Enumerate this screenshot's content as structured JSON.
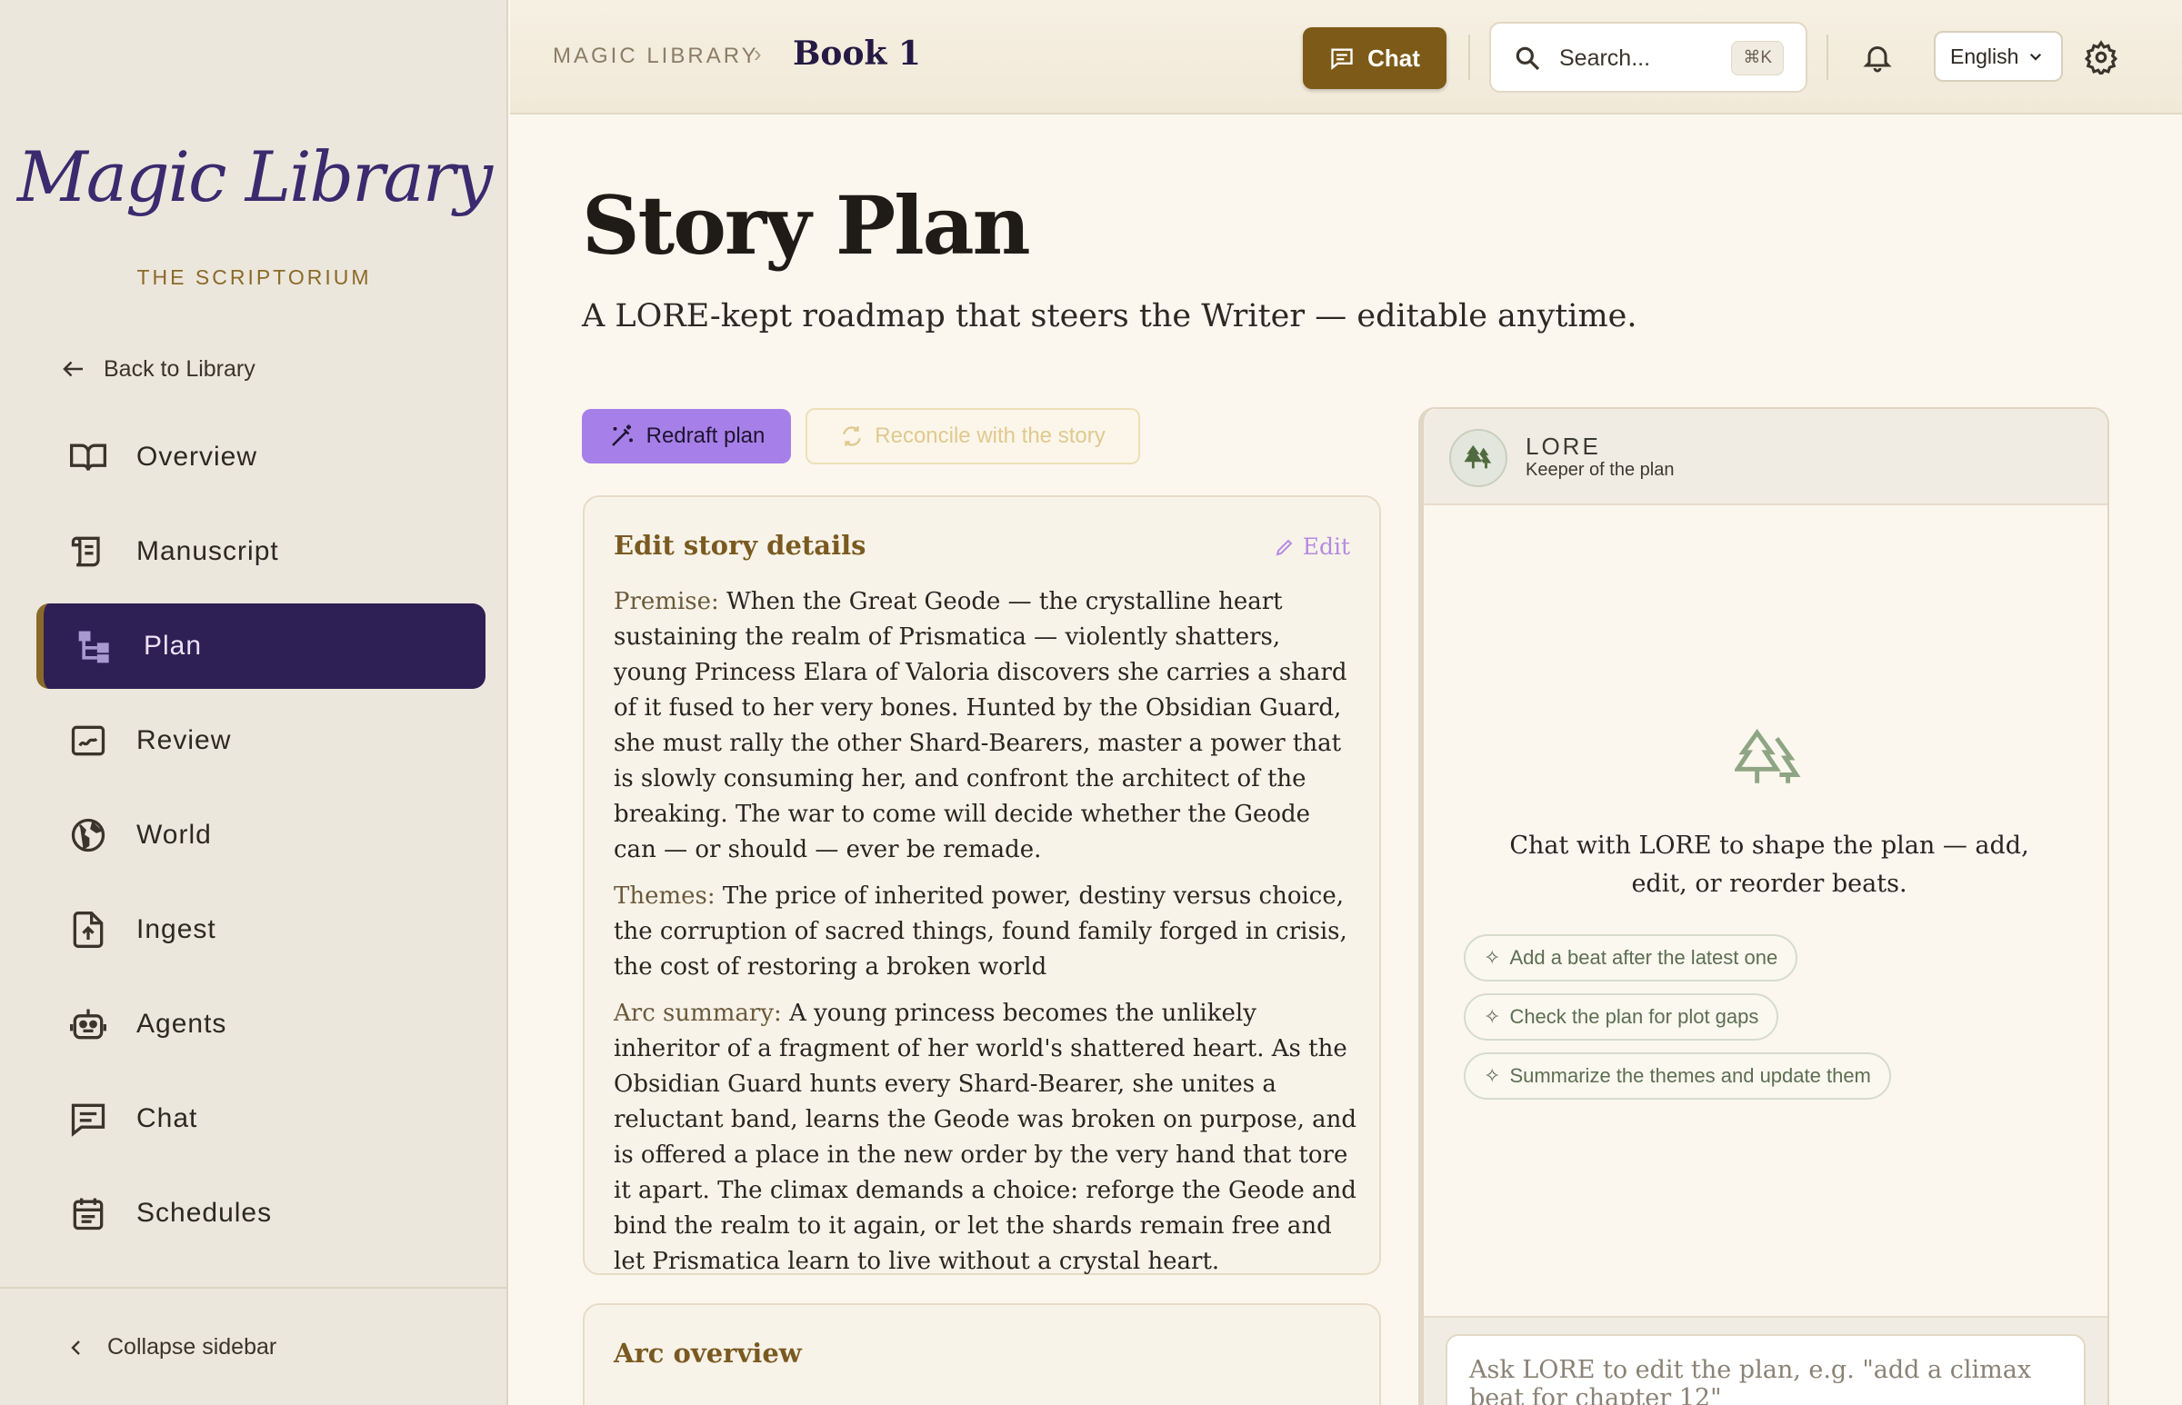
{
  "sidebar": {
    "logo": "Magic Library",
    "subtitle": "THE SCRIPTORIUM",
    "back": "Back to Library",
    "items": [
      {
        "label": "Overview",
        "icon": "open-book-icon"
      },
      {
        "label": "Manuscript",
        "icon": "scroll-icon"
      },
      {
        "label": "Plan",
        "icon": "hierarchy-icon",
        "active": true
      },
      {
        "label": "Review",
        "icon": "review-icon"
      },
      {
        "label": "World",
        "icon": "globe-icon"
      },
      {
        "label": "Ingest",
        "icon": "file-upload-icon"
      },
      {
        "label": "Agents",
        "icon": "robot-icon"
      },
      {
        "label": "Chat",
        "icon": "chat-icon"
      },
      {
        "label": "Schedules",
        "icon": "calendar-icon"
      }
    ],
    "collapse": "Collapse sidebar"
  },
  "topbar": {
    "breadcrumb_root": "MAGIC LIBRARY",
    "breadcrumb_sep": "›",
    "breadcrumb_current": "Book 1",
    "chat_label": "Chat",
    "search_placeholder": "Search...",
    "search_shortcut": "⌘K",
    "language": "English"
  },
  "main": {
    "title": "Story Plan",
    "subtitle": "A LORE-kept roadmap that steers the Writer — editable anytime.",
    "redraft_label": "Redraft plan",
    "reconcile_label": "Reconcile with the story",
    "details": {
      "title": "Edit story details",
      "edit_label": "Edit",
      "premise_label": "Premise:",
      "premise": "When the Great Geode — the crystalline heart sustaining the realm of Prismatica — violently shatters, young Princess Elara of Valoria discovers she carries a shard of it fused to her very bones. Hunted by the Obsidian Guard, she must rally the other Shard-Bearers, master a power that is slowly consuming her, and confront the architect of the breaking. The war to come will decide whether the Geode can — or should — ever be remade.",
      "themes_label": "Themes:",
      "themes": "The price of inherited power, destiny versus choice, the corruption of sacred things, found family forged in crisis, the cost of restoring a broken world",
      "arc_label": "Arc summary:",
      "arc": "A young princess becomes the unlikely inheritor of a fragment of her world's shattered heart. As the Obsidian Guard hunts every Shard-Bearer, she unites a reluctant band, learns the Geode was broken on purpose, and is offered a place in the new order by the very hand that tore it apart. The climax demands a choice: reforge the Geode and bind the realm to it again, or let the shards remain free and let Prismatica learn to live without a crystal heart."
    },
    "arc_overview_title": "Arc overview"
  },
  "lore": {
    "name": "LORE",
    "role": "Keeper of the plan",
    "empty_text": "Chat with LORE to shape the plan — add, edit, or reorder beats.",
    "suggestions": [
      "Add a beat after the latest one",
      "Check the plan for plot gaps",
      "Summarize the themes and update them"
    ],
    "input_placeholder": "Ask LORE to edit the plan, e.g. \"add a climax beat for chapter 12\""
  },
  "colors": {
    "accent_purple": "#2e1f54",
    "accent_gold": "#7d5a17",
    "redraft_purple": "#a77fe8",
    "lore_green": "#5d6e52"
  }
}
